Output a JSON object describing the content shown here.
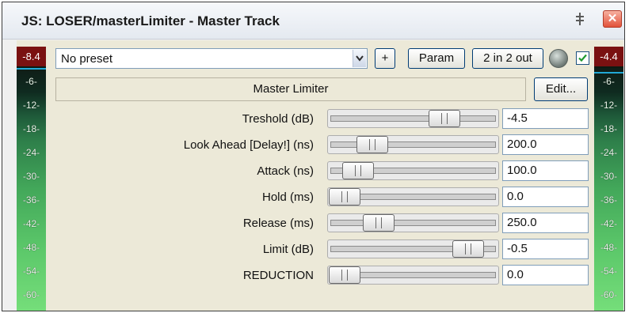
{
  "window": {
    "title": "JS: LOSER/masterLimiter - Master Track",
    "close_label": "✕",
    "pin_icon": "pin-icon",
    "close_icon": "close-icon"
  },
  "meters": {
    "left_peak": "-8.4",
    "right_peak": "-4.4",
    "scale": [
      "-6-",
      "-12-",
      "-18-",
      "-24-",
      "-30-",
      "-36-",
      "-42-",
      "-48-",
      "-54-",
      "-60-"
    ]
  },
  "toolbar": {
    "preset_value": "No preset",
    "add_label": "+",
    "param_label": "Param",
    "routing_label": "2 in 2 out",
    "enabled": true
  },
  "plugin": {
    "name": "Master Limiter",
    "edit_label": "Edit..."
  },
  "params": [
    {
      "label": "Treshold (dB)",
      "value": "-4.5",
      "level": 0.73
    },
    {
      "label": "Look Ahead [Delay!] (ns)",
      "value": "200.0",
      "level": 0.2
    },
    {
      "label": "Attack (ns)",
      "value": "100.0",
      "level": 0.1
    },
    {
      "label": "Hold (ms)",
      "value": "0.0",
      "level": 0.0
    },
    {
      "label": "Release (ms)",
      "value": "250.0",
      "level": 0.25
    },
    {
      "label": "Limit (dB)",
      "value": "-0.5",
      "level": 0.9
    },
    {
      "label": "REDUCTION",
      "value": "0.0",
      "level": 0.0
    }
  ],
  "colors": {
    "peak": "#7a1111",
    "meter_top": "#0f1d17",
    "meter_bottom": "#75de7a",
    "accent": "#22a9d6",
    "check": "#1e9a2e"
  }
}
